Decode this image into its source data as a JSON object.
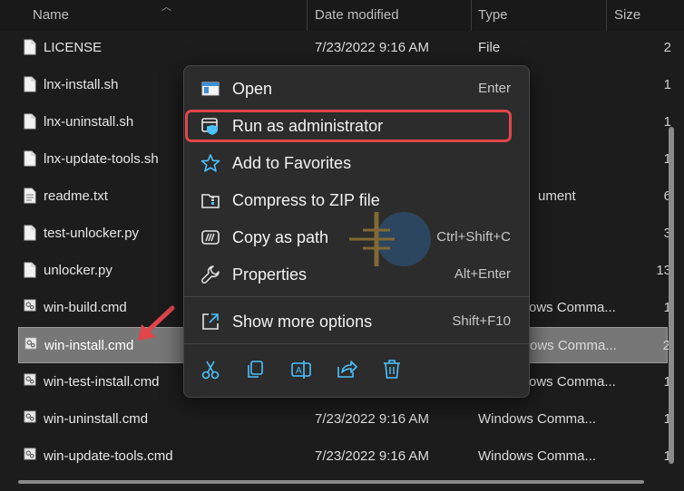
{
  "header": {
    "name": "Name",
    "date_modified": "Date modified",
    "type": "Type",
    "size": "Size"
  },
  "files": [
    {
      "name": "LICENSE",
      "icon": "file-icon",
      "date": "7/23/2022 9:16 AM",
      "type": "File",
      "size": "2"
    },
    {
      "name": "lnx-install.sh",
      "icon": "file-icon",
      "date": "",
      "type": "",
      "size": "1"
    },
    {
      "name": "lnx-uninstall.sh",
      "icon": "file-icon",
      "date": "",
      "type": "",
      "size": "1"
    },
    {
      "name": "lnx-update-tools.sh",
      "icon": "file-icon",
      "date": "",
      "type": "",
      "size": "1"
    },
    {
      "name": "readme.txt",
      "icon": "text-file-icon",
      "date": "",
      "type": "ument",
      "size": "6"
    },
    {
      "name": "test-unlocker.py",
      "icon": "file-icon",
      "date": "",
      "type": "",
      "size": "3"
    },
    {
      "name": "unlocker.py",
      "icon": "file-icon",
      "date": "",
      "type": "",
      "size": "13"
    },
    {
      "name": "win-build.cmd",
      "icon": "cmd-file-icon",
      "date": "",
      "type": "ows Comma...",
      "size": "1"
    },
    {
      "name": "win-install.cmd",
      "icon": "cmd-file-icon",
      "date": "",
      "type": "ows Comma...",
      "size": "2",
      "selected": true
    },
    {
      "name": "win-test-install.cmd",
      "icon": "cmd-file-icon",
      "date": "",
      "type": "ows Comma...",
      "size": "1"
    },
    {
      "name": "win-uninstall.cmd",
      "icon": "cmd-file-icon",
      "date": "7/23/2022 9:16 AM",
      "type": "Windows Comma...",
      "size": "1"
    },
    {
      "name": "win-update-tools.cmd",
      "icon": "cmd-file-icon",
      "date": "7/23/2022 9:16 AM",
      "type": "Windows Comma...",
      "size": "1"
    }
  ],
  "menu": {
    "items": [
      {
        "label": "Open",
        "shortcut": "Enter",
        "icon": "open-window-icon"
      },
      {
        "label": "Run as administrator",
        "shortcut": "",
        "icon": "shield-window-icon"
      },
      {
        "label": "Add to Favorites",
        "shortcut": "",
        "icon": "star-icon"
      },
      {
        "label": "Compress to ZIP file",
        "shortcut": "",
        "icon": "zip-folder-icon"
      },
      {
        "label": "Copy as path",
        "shortcut": "Ctrl+Shift+C",
        "icon": "copy-path-icon"
      },
      {
        "label": "Properties",
        "shortcut": "Alt+Enter",
        "icon": "wrench-icon"
      },
      {
        "label": "Show more options",
        "shortcut": "Shift+F10",
        "icon": "share-more-icon"
      }
    ],
    "quick_actions": [
      "cut-icon",
      "copy-icon",
      "rename-icon",
      "share-icon",
      "delete-icon"
    ]
  },
  "colors": {
    "highlight_border": "#e0464a",
    "accent_blue": "#4cc2ff",
    "selected_row": "#777777"
  }
}
